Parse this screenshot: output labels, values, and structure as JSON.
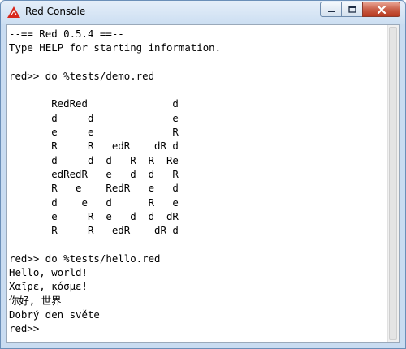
{
  "window": {
    "title": "Red Console",
    "icon": "red-logo-icon",
    "controls": {
      "minimize_icon": "minimize-icon",
      "maximize_icon": "maximize-icon",
      "close_icon": "close-icon"
    },
    "accent": "#c75a43"
  },
  "console": {
    "lines": [
      "--== Red 0.5.4 ==--",
      "Type HELP for starting information.",
      "",
      "red>> do %tests/demo.red",
      "",
      "       RedRed              d",
      "       d     d             e",
      "       e     e             R",
      "       R     R   edR    dR d",
      "       d     d  d   R  R  Re",
      "       edRedR   e   d  d   R",
      "       R   e    RedR   e   d",
      "       d    e   d      R   e",
      "       e     R  e   d  d  dR",
      "       R     R   edR    dR d",
      "",
      "red>> do %tests/hello.red",
      "Hello, world!",
      "Χαῖρε, κόσμε!",
      "你好, 世界",
      "Dobrý den světe",
      "red>>"
    ]
  }
}
